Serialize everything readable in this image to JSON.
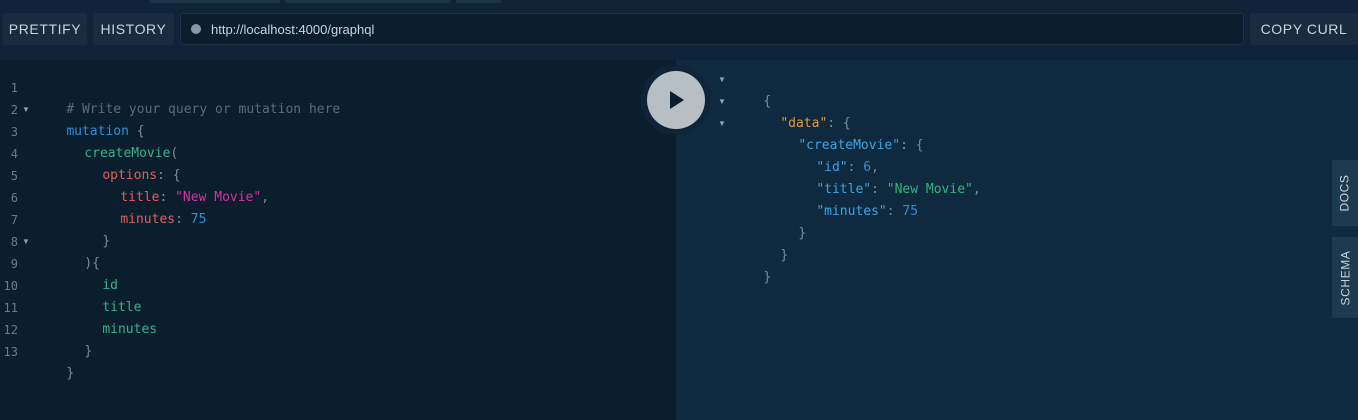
{
  "toolbar": {
    "prettify_label": "PRETTIFY",
    "history_label": "HISTORY",
    "url": "http://localhost:4000/graphql",
    "copy_curl_label": "COPY CURL"
  },
  "query_editor": {
    "line_numbers": [
      "1",
      "2",
      "3",
      "4",
      "5",
      "6",
      "7",
      "8",
      "9",
      "10",
      "11",
      "12",
      "13"
    ],
    "lines": {
      "l1": "# Write your query or mutation here",
      "l2_kw": "mutation",
      "l2_punc": " {",
      "l3_field": "createMovie",
      "l3_punc": "(",
      "l4_arg": "options",
      "l4_punc": ": {",
      "l5_arg": "title",
      "l5_punc": ": ",
      "l5_str": "\"New Movie\"",
      "l5_comma": ",",
      "l6_arg": "minutes",
      "l6_punc": ": ",
      "l6_num": "75",
      "l7_punc": "}",
      "l8_punc": "){",
      "l9_field": "id",
      "l10_field": "title",
      "l11_field": "minutes",
      "l12_punc": "}",
      "l13_punc": "}"
    }
  },
  "result": {
    "r1": "{",
    "r2_key": "\"data\"",
    "r2_punc": ": {",
    "r3_key": "\"createMovie\"",
    "r3_punc": ": {",
    "r4_key": "\"id\"",
    "r4_punc": ": ",
    "r4_val": "6",
    "r4_comma": ",",
    "r5_key": "\"title\"",
    "r5_punc": ": ",
    "r5_val": "\"New Movie\"",
    "r5_comma": ",",
    "r6_key": "\"minutes\"",
    "r6_punc": ": ",
    "r6_val": "75",
    "r7": "}",
    "r8": "}",
    "r9": "}"
  },
  "side_tabs": {
    "docs_label": "DOCS",
    "schema_label": "SCHEMA"
  },
  "icons": {
    "play": "play-icon",
    "fold": "fold-arrow-icon",
    "url_status": "status-dot-icon"
  }
}
